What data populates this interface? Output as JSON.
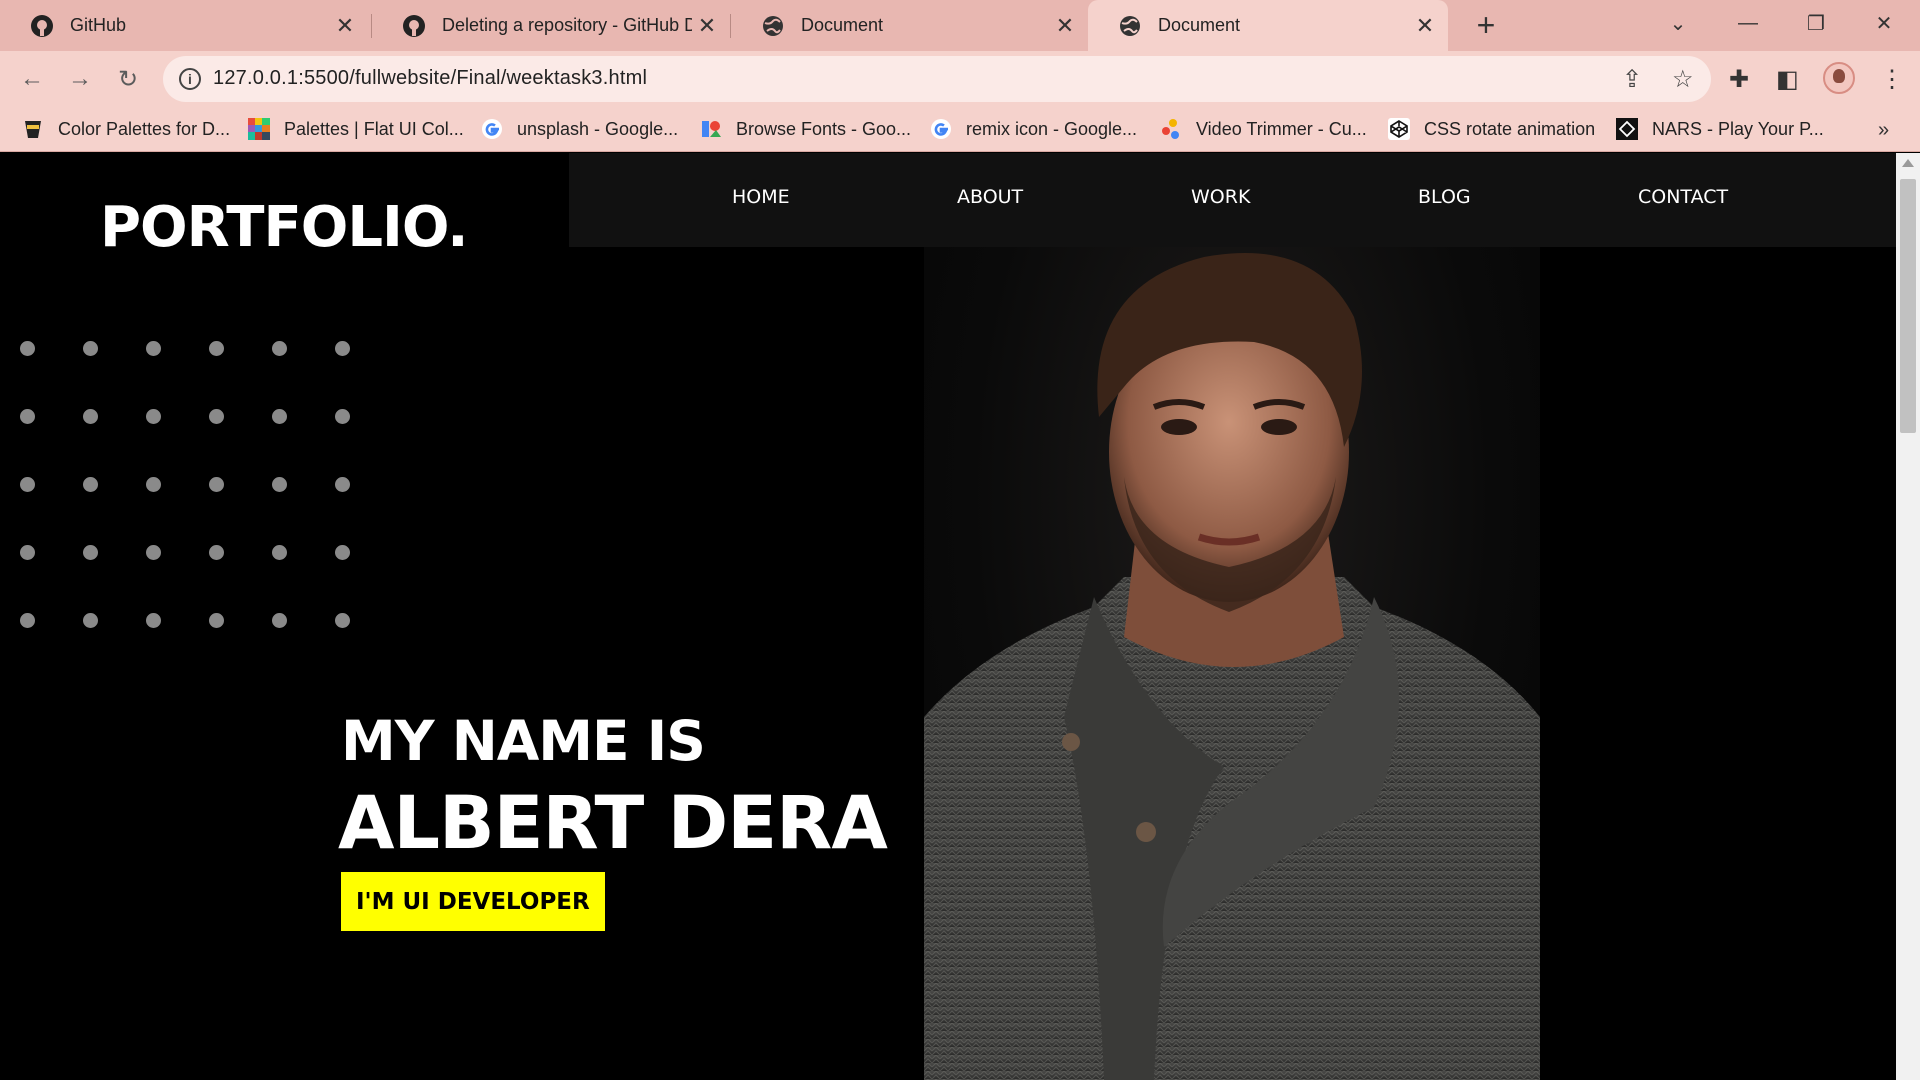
{
  "browser": {
    "tabs": [
      {
        "title": "GitHub",
        "icon": "github-icon",
        "active": false
      },
      {
        "title": "Deleting a repository - GitHub Docs",
        "icon": "github-icon",
        "active": false
      },
      {
        "title": "Document",
        "icon": "globe-icon",
        "active": false
      },
      {
        "title": "Document",
        "icon": "globe-icon",
        "active": true
      }
    ],
    "address_url": "127.0.0.1:5500/fullwebsite/Final/weektask3.html",
    "bookmarks": [
      {
        "label": "Color Palettes for D...",
        "icon": "palette-cup-icon"
      },
      {
        "label": "Palettes | Flat UI Col...",
        "icon": "flat-ui-grid-icon"
      },
      {
        "label": "unsplash - Google...",
        "icon": "google-icon"
      },
      {
        "label": "Browse Fonts - Goo...",
        "icon": "google-fonts-icon"
      },
      {
        "label": "remix icon - Google...",
        "icon": "google-icon"
      },
      {
        "label": "Video Trimmer - Cu...",
        "icon": "video-trimmer-icon"
      },
      {
        "label": "CSS rotate animation",
        "icon": "codepen-icon"
      },
      {
        "label": "NARS - Play Your P...",
        "icon": "nars-icon"
      }
    ]
  },
  "site": {
    "logo": "PORTFOLIO.",
    "nav": [
      "HOME",
      "ABOUT",
      "WORK",
      "BLOG",
      "CONTACT"
    ],
    "hero": {
      "intro": "MY NAME IS",
      "name": "ALBERT DERA",
      "role": "I'M UI DEVELOPER"
    }
  },
  "colors": {
    "chrome_tabbar": "#e8b7b1",
    "chrome_toolbar": "#f5d2cc",
    "page_background": "#000000",
    "nav_background": "#111111",
    "accent_yellow": "#ffff00",
    "dots": "#8a8a8a"
  }
}
